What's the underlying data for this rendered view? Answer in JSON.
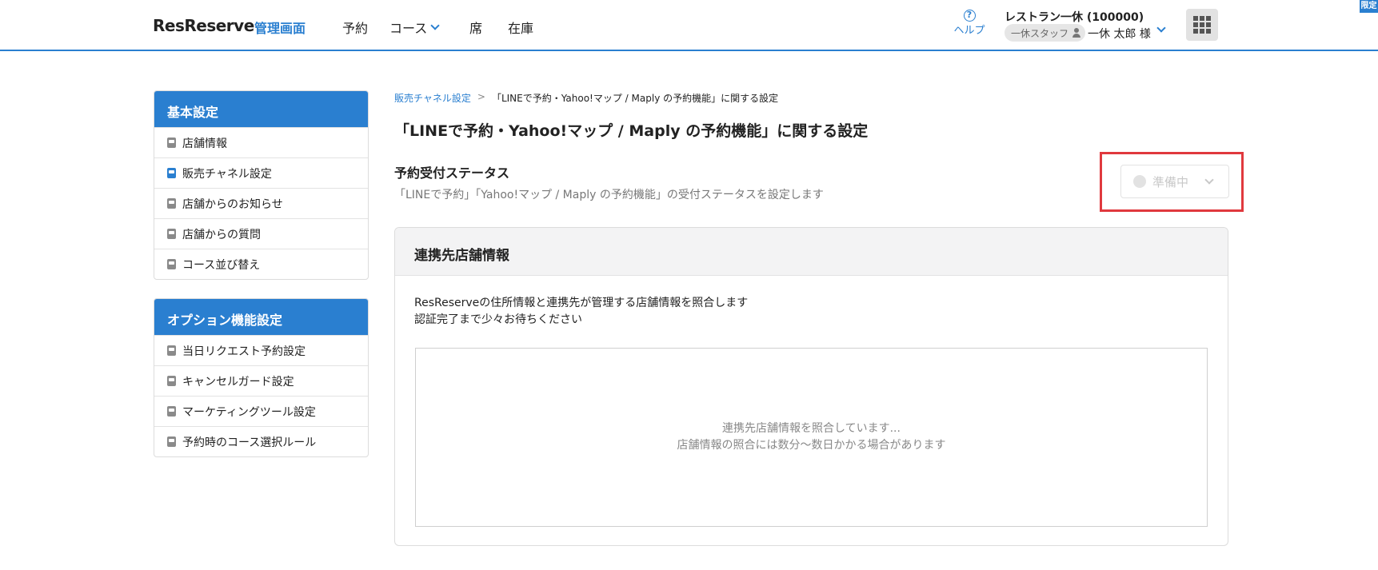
{
  "header": {
    "logo": "ResReserve",
    "logo_sub": "管理画面",
    "nav": [
      {
        "label": "予約"
      },
      {
        "label": "コース"
      },
      {
        "label": "席"
      },
      {
        "label": "在庫"
      }
    ],
    "help_label": "ヘルプ",
    "help_icon": "question-circle-icon",
    "restaurant": "レストラン一休 (100000)",
    "staff_badge": "一休スタッフ",
    "user_name": "一休 太郎 様",
    "corner_tag": "限定",
    "accent_color": "#2a7fd0"
  },
  "sidebar": {
    "basic": {
      "title": "基本設定",
      "items": [
        {
          "label": "店舗情報"
        },
        {
          "label": "販売チャネル設定",
          "active": true
        },
        {
          "label": "店舗からのお知らせ"
        },
        {
          "label": "店舗からの質問"
        },
        {
          "label": "コース並び替え"
        }
      ]
    },
    "options": {
      "title": "オプション機能設定",
      "items": [
        {
          "label": "当日リクエスト予約設定"
        },
        {
          "label": "キャンセルガード設定"
        },
        {
          "label": "マーケティングツール設定"
        },
        {
          "label": "予約時のコース選択ルール"
        }
      ]
    }
  },
  "main": {
    "breadcrumb": {
      "link": "販売チャネル設定",
      "separator": ">",
      "current": "「LINEで予約・Yahoo!マップ / Maply の予約機能」に関する設定"
    },
    "title": "「LINEで予約・Yahoo!マップ / Maply の予約機能」に関する設定",
    "status": {
      "title": "予約受付ステータス",
      "description": "「LINEで予約」「Yahoo!マップ / Maply の予約機能」の受付ステータスを設定します",
      "selected": "準備中",
      "highlight_color": "#e0393e"
    },
    "card": {
      "title": "連携先店舗情報",
      "desc_line1": "ResReserveの住所情報と連携先が管理する店舗情報を照合します",
      "desc_line2": "認証完了まで少々お待ちください",
      "pending_line1": "連携先店舗情報を照合しています...",
      "pending_line2": "店舗情報の照合には数分〜数日かかる場合があります"
    }
  }
}
